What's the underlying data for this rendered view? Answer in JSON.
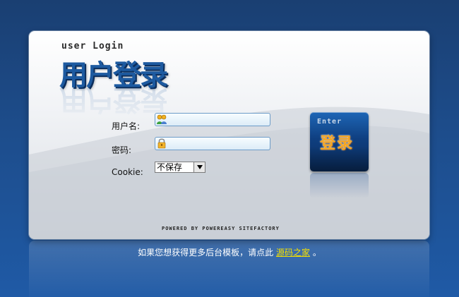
{
  "header": {
    "eng_title": "user Login",
    "cn_title": "用户登录"
  },
  "form": {
    "username_label": "用户名:",
    "password_label": "密码:",
    "cookie_label": "Cookie:",
    "username_value": "",
    "password_value": "",
    "cookie_selected": "不保存"
  },
  "button": {
    "enter_word": "Enter",
    "login_text": "登录"
  },
  "powered_by": "POWERED BY POWEREASY SITEFACTORY",
  "footer": {
    "text": "如果您想获得更多后台模板，请点此",
    "link_text": "源码之家",
    "suffix": "。"
  },
  "colors": {
    "background": "#1d4d8c",
    "accent_blue": "#1d5aa0",
    "button_orange": "#f5a623",
    "link_yellow": "#f5e000"
  },
  "icons": {
    "username": "user-group-icon",
    "password": "lock-icon"
  }
}
